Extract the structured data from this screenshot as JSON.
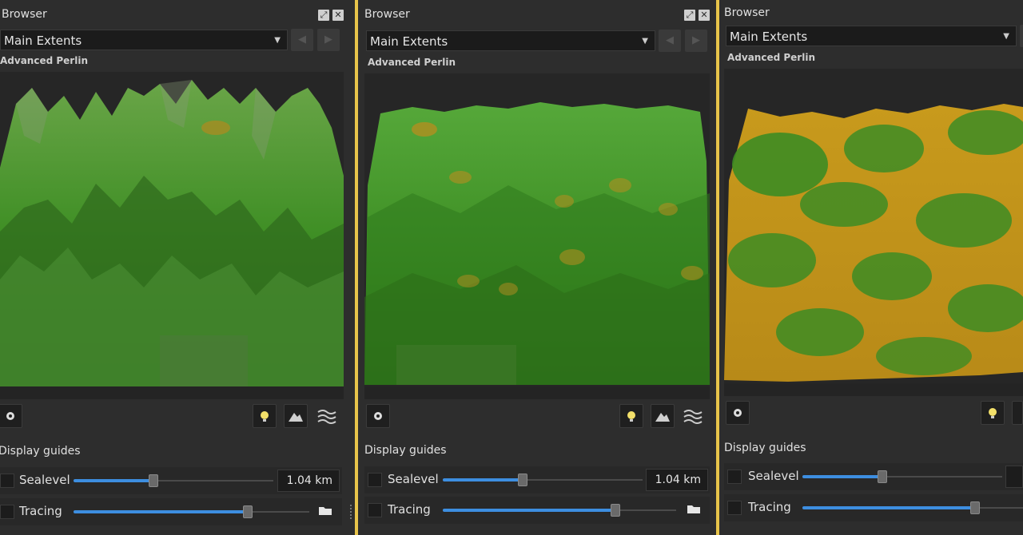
{
  "panels": [
    {
      "title": "Browser",
      "extents": "Main Extents",
      "node": "Advanced Perlin",
      "display_guides": "Display guides",
      "sealevel_label": "Sealevel",
      "sealevel_value": "1.04 km",
      "sealevel_fraction": 0.4,
      "tracing_label": "Tracing",
      "tracing_fraction": 0.74
    },
    {
      "title": "Browser",
      "extents": "Main Extents",
      "node": "Advanced Perlin",
      "display_guides": "Display guides",
      "sealevel_label": "Sealevel",
      "sealevel_value": "1.04 km",
      "sealevel_fraction": 0.4,
      "tracing_label": "Tracing",
      "tracing_fraction": 0.74
    },
    {
      "title": "Browser",
      "extents": "Main Extents",
      "node": "Advanced Perlin",
      "display_guides": "Display guides",
      "sealevel_label": "Sealevel",
      "sealevel_fraction": 0.4,
      "tracing_label": "Tracing",
      "tracing_fraction": 0.74
    }
  ],
  "icons": {
    "restore": "restore-icon",
    "close": "close-icon",
    "back": "arrow-left-icon",
    "forward": "arrow-right-icon",
    "settings": "gear-icon",
    "light": "light-bulb-icon",
    "terrain": "terrain-icon",
    "water": "water-icon",
    "folder": "folder-icon"
  },
  "colors": {
    "accent_slider": "#3d8ee0",
    "panel_border": "#e8c44a",
    "terrain_green": "#3f8f25",
    "terrain_gold": "#c89a1c"
  }
}
